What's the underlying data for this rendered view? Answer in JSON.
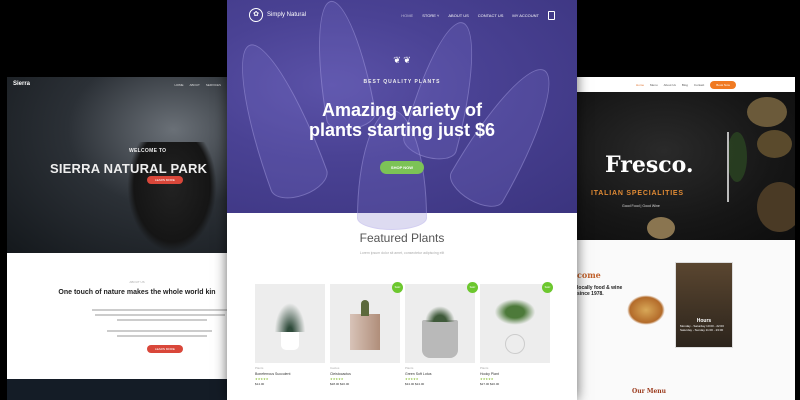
{
  "left_site": {
    "brand": "Sierra",
    "nav": [
      "HOME",
      "ABOUT",
      "SERVICES"
    ],
    "pretitle": "WELCOME TO",
    "title": "SIERRA NATURAL PARK",
    "hero_button": "LEARN MORE",
    "about_label": "ABOUT US",
    "heading": "One touch of nature makes the whole world kin",
    "section_button": "LEARN MORE"
  },
  "center_site": {
    "brand": "Simply Natural",
    "nav": [
      "HOME",
      "STORE ˅",
      "ABOUT US",
      "CONTACT US",
      "MY ACCOUNT"
    ],
    "pretitle": "BEST QUALITY PLANTS",
    "headline": "Amazing variety of plants starting just $6",
    "cta": "SHOP NOW",
    "featured_title": "Featured Plants",
    "featured_subtitle": "Lorem ipsum dolor sit amet, consectetur adipiscing elit",
    "products": [
      {
        "category": "Plants",
        "name": "Boneferrous Succulent",
        "stars": "★★★★★",
        "price": "$14.00",
        "sale": ""
      },
      {
        "category": "Cactus",
        "name": "Cleistocactus",
        "stars": "★★★★★",
        "price": "$28.00 $20.00",
        "sale": "Sale!"
      },
      {
        "category": "Plants",
        "name": "Green Soft Lotus",
        "stars": "★★★★★",
        "price": "$34.00 $24.00",
        "sale": "Sale!"
      },
      {
        "category": "Plants",
        "name": "Hooky Plant",
        "stars": "★★★★★",
        "price": "$27.00 $20.00",
        "sale": "Sale!"
      }
    ],
    "colors": {
      "hero": "#4a4294",
      "accent": "#7cc356"
    }
  },
  "right_site": {
    "nav": [
      "Home",
      "Menu",
      "About Us",
      "Blog",
      "Contact"
    ],
    "book_button": "Book Now",
    "brand": "Fresco.",
    "tagline": "ITALIAN SPECIALITIES",
    "subtag": "Good Food | Good Wine",
    "welcome": "come",
    "welcome_text": "locally food & wine since 1978.",
    "hours_title": "Hours",
    "hours_lines": [
      "Monday - Saturday 10:00 - 22:00",
      "Saturday - Sunday 11:00 - 23:00"
    ],
    "menu_title": "Our Menu"
  }
}
